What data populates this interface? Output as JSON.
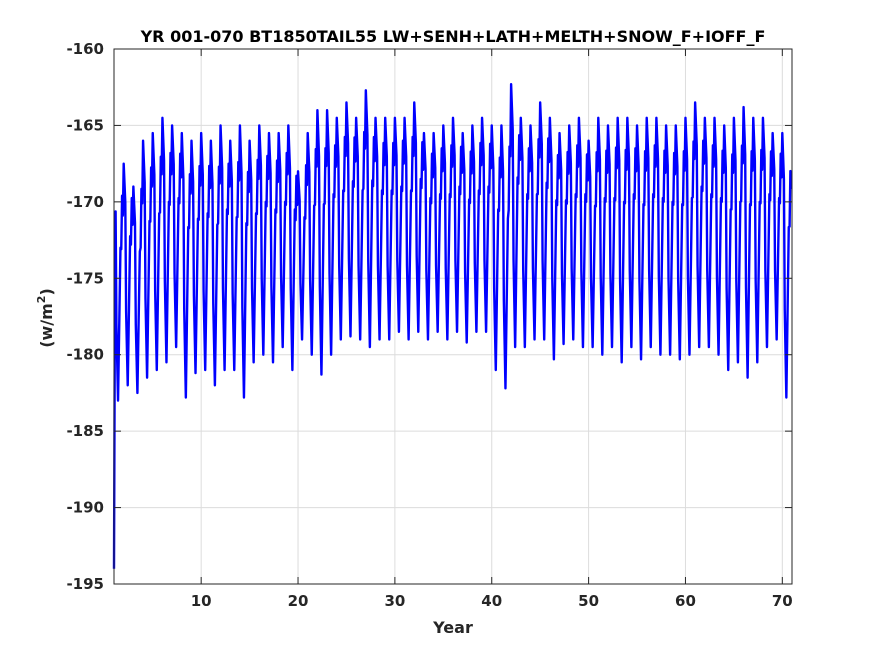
{
  "chart_data": {
    "type": "line",
    "title": "YR 001-070 BT1850TAIL55 LW+SENH+LATH+MELTH+SNOW_F+IOFF_F",
    "xlabel": "Year",
    "ylabel_base": "(w/m",
    "ylabel_exp": "2",
    "ylabel_close": ")",
    "xlim": [
      1,
      71
    ],
    "ylim": [
      -195,
      -160
    ],
    "xticks": [
      10,
      20,
      30,
      40,
      50,
      60,
      70
    ],
    "yticks": [
      -160,
      -165,
      -170,
      -175,
      -180,
      -185,
      -190,
      -195
    ],
    "xtick_labels": [
      "10",
      "20",
      "30",
      "40",
      "50",
      "60",
      "70"
    ],
    "ytick_labels": [
      "-160",
      "-165",
      "-170",
      "-175",
      "-180",
      "-185",
      "-190",
      "-195"
    ],
    "grid": true,
    "line_color": "#0000ff",
    "samples_per_year": 12,
    "initial_value": -194,
    "annual_max": [
      -168,
      -167.5,
      -169,
      -166,
      -165.5,
      -164.5,
      -165,
      -165.5,
      -166,
      -165.5,
      -166,
      -165,
      -166,
      -165,
      -166,
      -165,
      -165.5,
      -165.5,
      -165,
      -168,
      -165.5,
      -164,
      -164,
      -164.5,
      -163.5,
      -164.5,
      -162.7,
      -164.5,
      -164.5,
      -164.5,
      -164.5,
      -163.5,
      -165.5,
      -165.5,
      -165,
      -164.5,
      -165.5,
      -165,
      -164.5,
      -165,
      -165,
      -162.3,
      -164.5,
      -165,
      -163.5,
      -164.5,
      -165.5,
      -165,
      -164.5,
      -166,
      -164.5,
      -165,
      -164.5,
      -164.5,
      -165,
      -164.5,
      -164.5,
      -165,
      -165,
      -164.5,
      -163.5,
      -164.5,
      -164.5,
      -165,
      -164.5,
      -163.8,
      -164.5,
      -164.5,
      -165.5,
      -165.5
    ],
    "annual_min": [
      -183,
      -182,
      -182.5,
      -181.5,
      -181,
      -180.5,
      -179.5,
      -182.8,
      -181.2,
      -181,
      -182,
      -181,
      -181,
      -182.8,
      -180.5,
      -180,
      -180.5,
      -179.5,
      -181,
      -179,
      -180,
      -181.3,
      -180,
      -179,
      -178.8,
      -179,
      -179.5,
      -179,
      -179,
      -178.5,
      -179,
      -178.5,
      -179,
      -178.5,
      -179,
      -178.5,
      -179.2,
      -178.5,
      -178.5,
      -181,
      -182.2,
      -179.5,
      -179.5,
      -179,
      -179,
      -180.3,
      -179.3,
      -179,
      -179.5,
      -179.5,
      -180,
      -179.5,
      -180.5,
      -179.5,
      -180.3,
      -179.5,
      -180,
      -180,
      -180.3,
      -180,
      -179.5,
      -179.5,
      -180,
      -181,
      -180.5,
      -181.5,
      -180.5,
      -179.5,
      -179,
      -182.8
    ]
  }
}
